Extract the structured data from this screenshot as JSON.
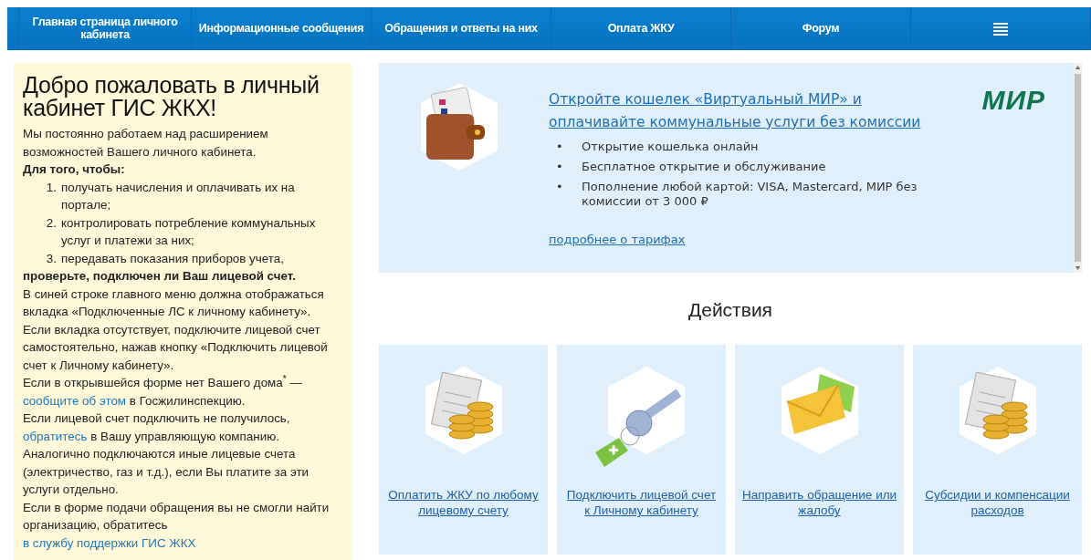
{
  "nav": {
    "items": [
      {
        "label": "Главная страница личного кабинета",
        "kind": "text"
      },
      {
        "label": "Информационные сообщения",
        "kind": "text"
      },
      {
        "label": "Обращения и ответы на них",
        "kind": "text"
      },
      {
        "label": "Оплата ЖКУ",
        "kind": "text"
      },
      {
        "label": "Форум",
        "kind": "text"
      },
      {
        "kind": "menu"
      }
    ]
  },
  "welcome": {
    "title": "Добро пожаловать в личный кабинет ГИС ЖКХ!",
    "blocks": [
      {
        "kind": "para",
        "text": "Мы постоянно работаем над расширением возможностей Вашего личного кабинета."
      },
      {
        "kind": "bold",
        "text": "Для того, чтобы:"
      },
      {
        "kind": "list",
        "items": [
          {
            "marker": "1.",
            "text": "получать начисления и оплачивать их на портале;"
          },
          {
            "marker": "2.",
            "text": "контролировать потребление коммунальных услуг и платежи за них;"
          },
          {
            "marker": "3.",
            "text": "передавать показания приборов учета,"
          }
        ]
      },
      {
        "kind": "bold",
        "text": "проверьте, подключен ли Ваш лицевой счет."
      },
      {
        "kind": "para",
        "text": "В синей строке главного меню должна отображаться вкладка «Подключенные ЛС к личному кабинету»."
      },
      {
        "kind": "para",
        "text": "Если вкладка отсутствует, подключите лицевой счет самостоятельно, нажав кнопку «Подключить лицевой счет к Личному кабинету»."
      },
      {
        "kind": "para",
        "parts": [
          {
            "text": "Если в открывшейся форме нет Вашего дома$^{*}$ — ",
            "kind": "text"
          },
          {
            "text": "сообщите об этом",
            "kind": "link"
          },
          {
            "text": " в Госжилинспекцию.",
            "kind": "text"
          }
        ]
      },
      {
        "kind": "para",
        "parts": [
          {
            "text": "Если лицевой счет подключить не получилось, ",
            "kind": "text"
          },
          {
            "text": "обратитесь",
            "kind": "link"
          },
          {
            "text": " в Вашу управляющую компанию.",
            "kind": "text"
          }
        ]
      },
      {
        "kind": "para",
        "text": "Аналогично подключаются иные лицевые счета (электричество, газ и т.д.), если Вы платите за эти услуги отдельно."
      },
      {
        "kind": "para",
        "parts": [
          {
            "text": "Если в форме подачи обращения вы не смогли найти организацию, обратитесь ",
            "kind": "text"
          },
          {
            "text": "в службу поддержки ГИС ЖКХ",
            "kind": "link"
          }
        ]
      }
    ]
  },
  "promo": {
    "title": "Откройте кошелек «Виртуальный МИР» и оплачивайте коммунальные услуги без комиссии",
    "bullets": [
      {
        "marker": "•",
        "text": "Открытие кошелька онлайн"
      },
      {
        "marker": "•",
        "text": "Бесплатное открытие и обслуживание"
      },
      {
        "marker": "•",
        "text": "Пополнение любой картой: VISA, Mastercard, МИР без комиссии от 3 000 ₽"
      }
    ],
    "more_link": "подробнее о тарифах",
    "logo": "МИР"
  },
  "actions": {
    "title": "Действия",
    "cards": [
      {
        "label": "Оплатить ЖКУ по любому лицевому счету",
        "kind": "coins"
      },
      {
        "label": "Подключить лицевой счет к Личному кабинету",
        "kind": "key"
      },
      {
        "label": "Направить обращение или жалобу",
        "kind": "mail"
      },
      {
        "label": "Субсидии и компенсации расходов",
        "kind": "coins"
      }
    ]
  }
}
